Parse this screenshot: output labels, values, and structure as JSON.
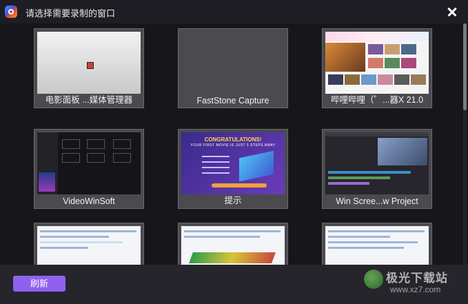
{
  "window": {
    "title": "请选择需要录制的窗口",
    "close_icon": "close-icon"
  },
  "windows": [
    {
      "label": "电影面板 ...媒体管理器"
    },
    {
      "label": "FastStone Capture"
    },
    {
      "label": "哔哩哔哩（゜...器X 21.0"
    },
    {
      "label": "VideoWinSoft"
    },
    {
      "label": "提示",
      "thumb_heading": "CONGRATULATIONS!",
      "thumb_sub": "YOUR FIRST MOVIE IS JUST 5 STEPS AWAY"
    },
    {
      "label": "Win Scree...w Project"
    },
    {
      "label": ""
    },
    {
      "label": ""
    },
    {
      "label": ""
    }
  ],
  "footer": {
    "refresh_label": "刷新"
  },
  "watermark": {
    "name": "极光下载站",
    "url": "www.xz7.com"
  },
  "colors": {
    "accent": "#8f61ef",
    "background": "#17161b",
    "card": "#4b4a4f"
  }
}
